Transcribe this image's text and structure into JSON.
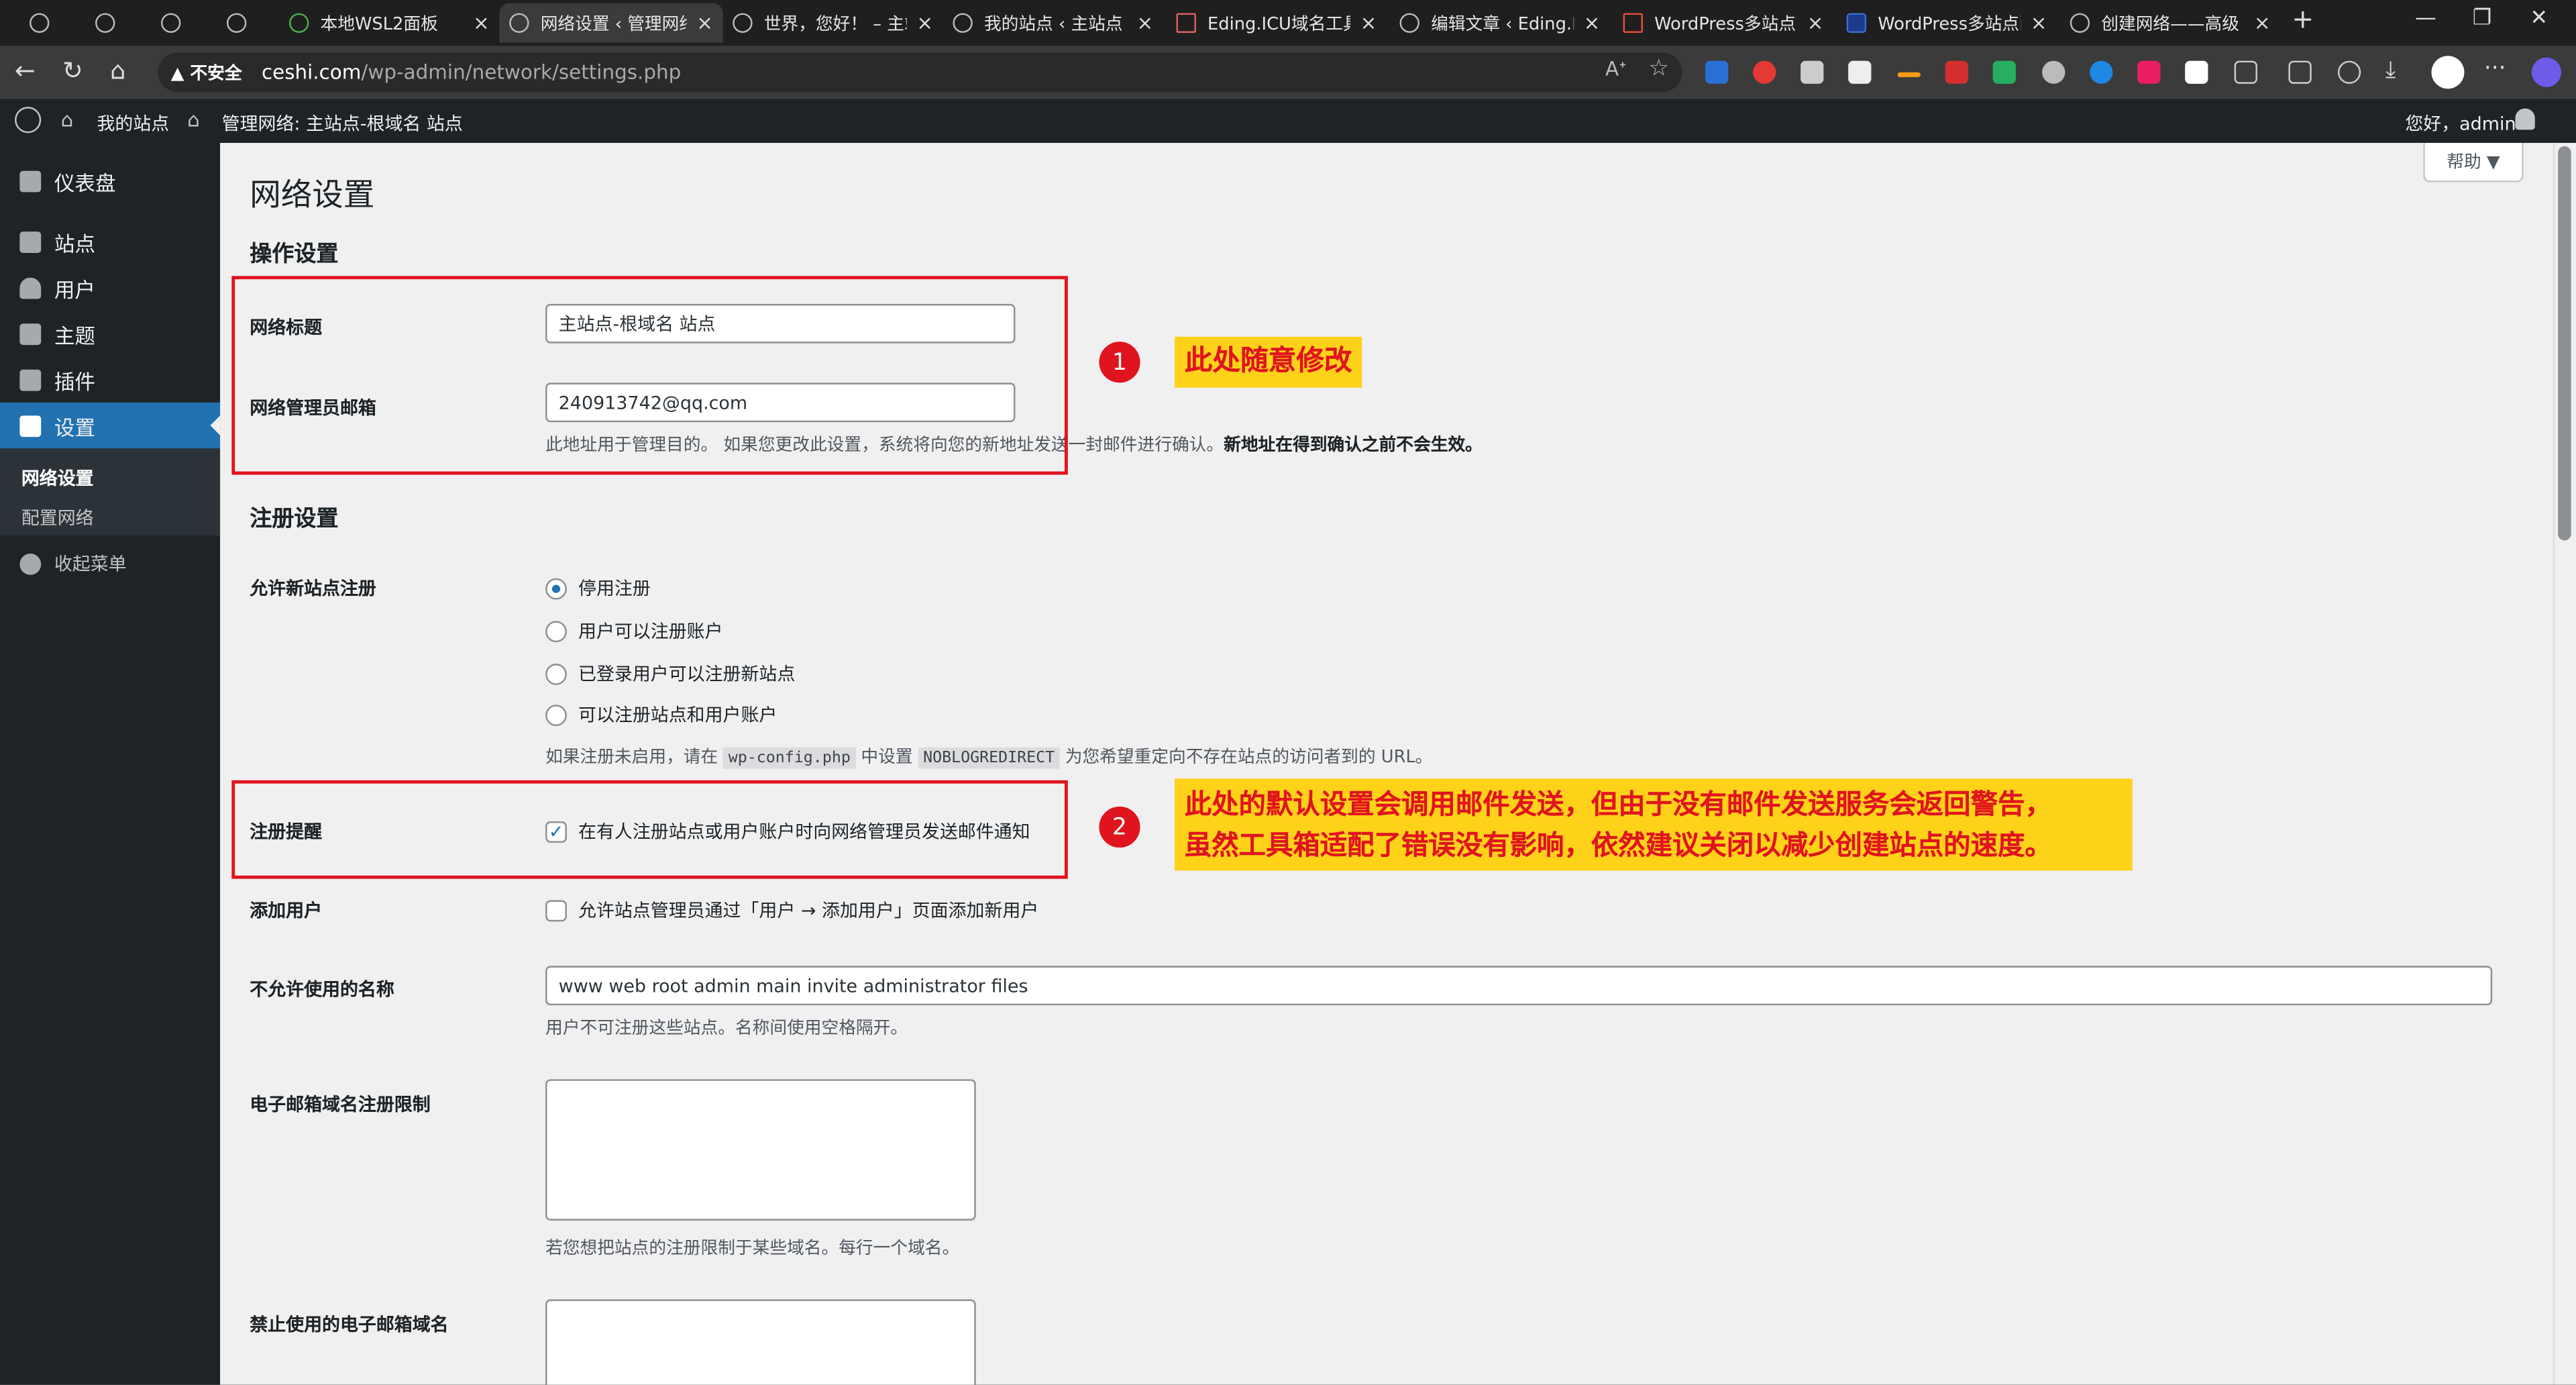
{
  "browser": {
    "tabs": [
      {
        "title": ""
      },
      {
        "title": ""
      },
      {
        "title": ""
      },
      {
        "title": ""
      },
      {
        "title": "本地WSL2面板"
      },
      {
        "title": "网络设置 ‹ 管理网络"
      },
      {
        "title": "世界，您好！ – 主站"
      },
      {
        "title": "我的站点 ‹ 主站点"
      },
      {
        "title": "Eding.ICU域名工具"
      },
      {
        "title": "编辑文章 ‹ Eding.IC"
      },
      {
        "title": "WordPress多站点"
      },
      {
        "title": "WordPress多站点配"
      },
      {
        "title": "创建网络——高级"
      }
    ],
    "new_tab": "+",
    "close_glyph": "×",
    "window_controls": {
      "minimize": "—",
      "restore": "❐",
      "close": "✕"
    },
    "nav": {
      "back": "←",
      "reload": "↻",
      "home": "⌂"
    },
    "address": {
      "security_label": "▲ 不安全",
      "host": "ceshi.com",
      "path": "/wp-admin/network/settings.php"
    }
  },
  "adminbar": {
    "my_sites": "我的站点",
    "network_admin": "管理网络: 主站点-根域名 站点",
    "greeting": "您好，admin"
  },
  "sidebar": {
    "items": [
      {
        "label": "仪表盘",
        "icon": "dashboard-icon"
      },
      {
        "label": "站点",
        "icon": "sites-icon"
      },
      {
        "label": "用户",
        "icon": "users-icon"
      },
      {
        "label": "主题",
        "icon": "themes-icon"
      },
      {
        "label": "插件",
        "icon": "plugins-icon"
      },
      {
        "label": "设置",
        "icon": "settings-icon"
      }
    ],
    "submenu": [
      "网络设置",
      "配置网络"
    ],
    "collapse": "收起菜单"
  },
  "page": {
    "help": "帮助 ▼",
    "title": "网络设置",
    "section_ops": "操作设置",
    "network_title_label": "网络标题",
    "network_title_value": "主站点-根域名 站点",
    "admin_email_label": "网络管理员邮箱",
    "admin_email_value": "240913742@qq.com",
    "admin_email_desc": "此地址用于管理目的。 如果您更改此设置，系统将向您的新地址发送一封邮件进行确认。",
    "admin_email_desc_bold": "新地址在得到确认之前不会生效。",
    "section_reg": "注册设置",
    "allow_reg_label": "允许新站点注册",
    "reg_options": [
      "停用注册",
      "用户可以注册账户",
      "已登录用户可以注册新站点",
      "可以注册站点和用户账户"
    ],
    "reg_desc_1": "如果注册未启用，请在",
    "reg_desc_code1": "wp-config.php",
    "reg_desc_2": "中设置",
    "reg_desc_code2": "NOBLOGREDIRECT",
    "reg_desc_3": "为您希望重定向不存在站点的访问者到的 URL。",
    "notify_label": "注册提醒",
    "notify_option": "在有人注册站点或用户账户时向网络管理员发送邮件通知",
    "add_user_label": "添加用户",
    "add_user_option": "允许站点管理员通过「用户 → 添加用户」页面添加新用户",
    "banned_names_label": "不允许使用的名称",
    "banned_names_value": "www web root admin main invite administrator files",
    "banned_names_desc": "用户不可注册这些站点。名称间使用空格隔开。",
    "email_limit_label": "电子邮箱域名注册限制",
    "email_limit_desc": "若您想把站点的注册限制于某些域名。每行一个域名。",
    "banned_email_label": "禁止使用的电子邮箱域名"
  },
  "annotations": {
    "badge1": "1",
    "note1": "此处随意修改",
    "badge2": "2",
    "note2_line1": "此处的默认设置会调用邮件发送，但由于没有邮件发送服务会返回警告，",
    "note2_line2": "虽然工具箱适配了错误没有影响，依然建议关闭以减少创建站点的速度。",
    "color": "#e0141e",
    "note_bg": "#ffd21a"
  }
}
